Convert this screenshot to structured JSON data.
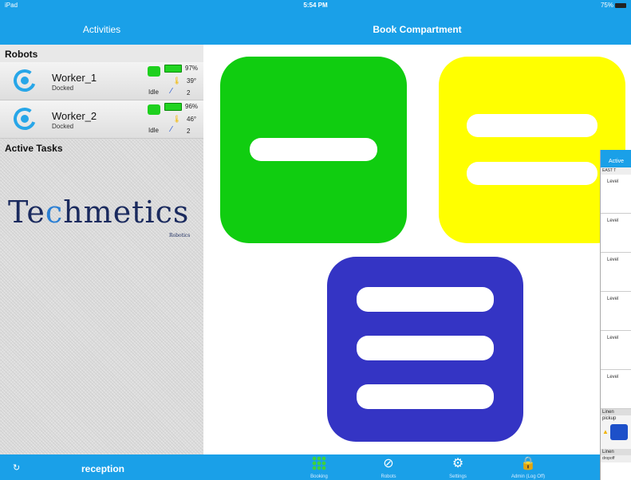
{
  "status_bar": {
    "device": "iPad",
    "time": "5:54 PM",
    "battery": "75%"
  },
  "left": {
    "nav_title": "Activities",
    "robots_header": "Robots",
    "robots": [
      {
        "name": "Worker_1",
        "state": "Docked",
        "battery": "97%",
        "temp": "39°",
        "activity": "Idle",
        "count": "2"
      },
      {
        "name": "Worker_2",
        "state": "Docked",
        "battery": "96%",
        "temp": "46°",
        "activity": "Idle",
        "count": "2"
      }
    ],
    "active_tasks_header": "Active Tasks",
    "brand": {
      "name_pre": "Te",
      "name_c": "c",
      "name_post": "hmetics",
      "tagline": "Robotics"
    },
    "footer_label": "reception"
  },
  "main": {
    "nav_title": "Book Compartment",
    "tiles": [
      {
        "name": "green",
        "color": "#10cd10",
        "bars": 1
      },
      {
        "name": "yellow",
        "color": "#ffff00",
        "bars": 2
      },
      {
        "name": "blue",
        "color": "#3434c4",
        "bars": 3
      }
    ]
  },
  "tabbar": {
    "items": [
      {
        "label": "Booking",
        "icon": "grid-icon"
      },
      {
        "label": "Robots",
        "icon": "compass-icon"
      },
      {
        "label": "Settings",
        "icon": "gears-icon"
      },
      {
        "label": "Admin (Log Off)",
        "icon": "lock-icon"
      }
    ]
  },
  "preview": {
    "nav": "Active",
    "header": "EAST T",
    "levels": [
      "Level",
      "Level",
      "Level",
      "Level",
      "Level",
      "Level"
    ],
    "linen_1": "Linen",
    "pickup": "pickup",
    "linen_2": "Linen",
    "dropoff": "dropoff"
  }
}
